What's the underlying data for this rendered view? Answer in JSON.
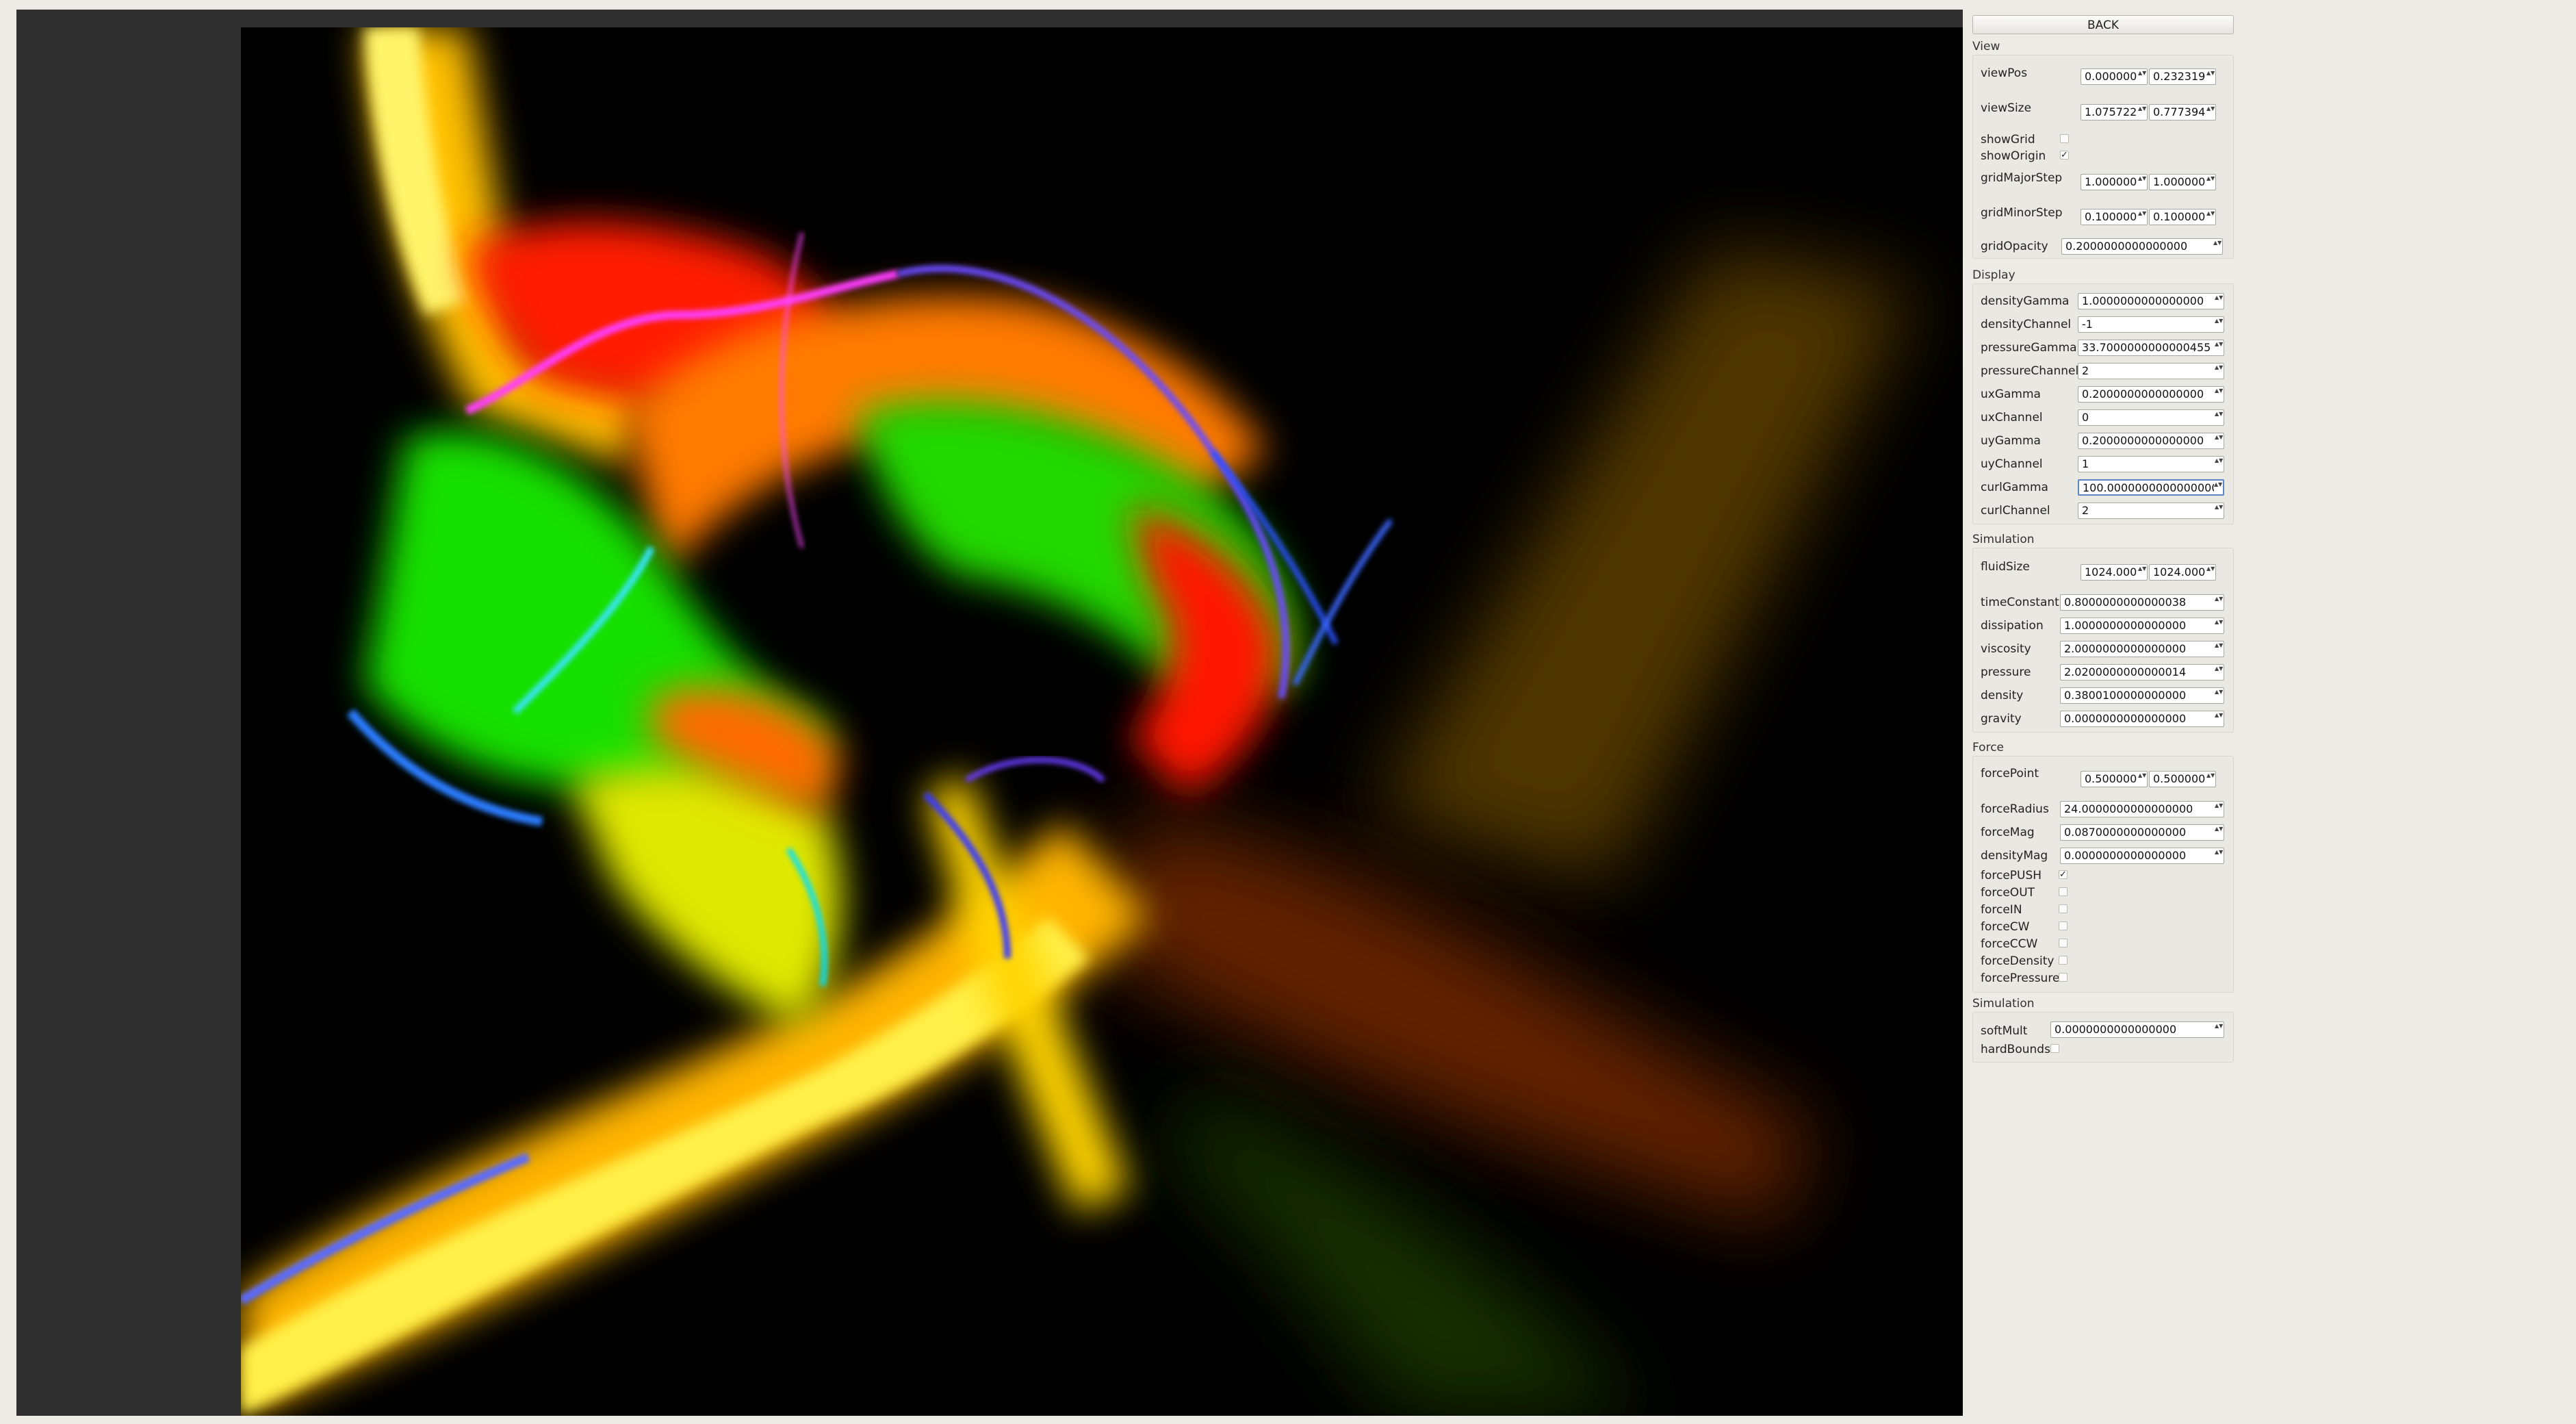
{
  "panel": {
    "back_label": "BACK",
    "sections": {
      "view": "View",
      "display": "Display",
      "simulation": "Simulation",
      "force": "Force",
      "simulation2": "Simulation"
    },
    "view": {
      "viewPos": {
        "label": "viewPos",
        "x": "0.000000",
        "y": "0.232319"
      },
      "viewSize": {
        "label": "viewSize",
        "x": "1.075722",
        "y": "0.777394"
      },
      "showGrid": {
        "label": "showGrid",
        "checked": false
      },
      "showOrigin": {
        "label": "showOrigin",
        "checked": true
      },
      "gridMajorStep": {
        "label": "gridMajorStep",
        "x": "1.000000",
        "y": "1.000000"
      },
      "gridMinorStep": {
        "label": "gridMinorStep",
        "x": "0.100000",
        "y": "0.100000"
      },
      "gridOpacity": {
        "label": "gridOpacity",
        "value": "0.2000000000000000"
      }
    },
    "display": {
      "densityGamma": {
        "label": "densityGamma",
        "value": "1.0000000000000000"
      },
      "densityChannel": {
        "label": "densityChannel",
        "value": "-1"
      },
      "pressureGamma": {
        "label": "pressureGamma",
        "value": "33.7000000000000455"
      },
      "pressureChannel": {
        "label": "pressureChannel",
        "value": "2"
      },
      "uxGamma": {
        "label": "uxGamma",
        "value": "0.2000000000000000"
      },
      "uxChannel": {
        "label": "uxChannel",
        "value": "0"
      },
      "uyGamma": {
        "label": "uyGamma",
        "value": "0.2000000000000000"
      },
      "uyChannel": {
        "label": "uyChannel",
        "value": "1"
      },
      "curlGamma": {
        "label": "curlGamma",
        "value": "100.0000000000000000"
      },
      "curlChannel": {
        "label": "curlChannel",
        "value": "2"
      }
    },
    "simulation": {
      "fluidSize": {
        "label": "fluidSize",
        "x": "1024.000",
        "y": "1024.000"
      },
      "timeConstant": {
        "label": "timeConstant",
        "value": "0.8000000000000038"
      },
      "dissipation": {
        "label": "dissipation",
        "value": "1.0000000000000000"
      },
      "viscosity": {
        "label": "viscosity",
        "value": "2.0000000000000000"
      },
      "pressure": {
        "label": "pressure",
        "value": "2.0200000000000014"
      },
      "density": {
        "label": "density",
        "value": "0.3800100000000000"
      },
      "gravity": {
        "label": "gravity",
        "value": "0.0000000000000000"
      }
    },
    "force": {
      "forcePoint": {
        "label": "forcePoint",
        "x": "0.500000",
        "y": "0.500000"
      },
      "forceRadius": {
        "label": "forceRadius",
        "value": "24.0000000000000000"
      },
      "forceMag": {
        "label": "forceMag",
        "value": "0.0870000000000000"
      },
      "densityMag": {
        "label": "densityMag",
        "value": "0.0000000000000000"
      },
      "forcePUSH": {
        "label": "forcePUSH",
        "checked": true
      },
      "forceOUT": {
        "label": "forceOUT",
        "checked": false
      },
      "forceIN": {
        "label": "forceIN",
        "checked": false
      },
      "forceCW": {
        "label": "forceCW",
        "checked": false
      },
      "forceCCW": {
        "label": "forceCCW",
        "checked": false
      },
      "forceDensity": {
        "label": "forceDensity",
        "checked": false
      },
      "forcePressure": {
        "label": "forcePressure",
        "checked": false
      }
    },
    "simulation2": {
      "softMult": {
        "label": "softMult",
        "value": "0.0000000000000000"
      },
      "hardBounds": {
        "label": "hardBounds",
        "checked": false
      }
    },
    "check_mark": "✓",
    "spin_arrows": "▲▼"
  },
  "colors": {
    "panel_bg": "#edebe6",
    "viewport_bg": "#303030",
    "canvas_bg": "#000000",
    "focus_ring": "#5a86c4"
  }
}
